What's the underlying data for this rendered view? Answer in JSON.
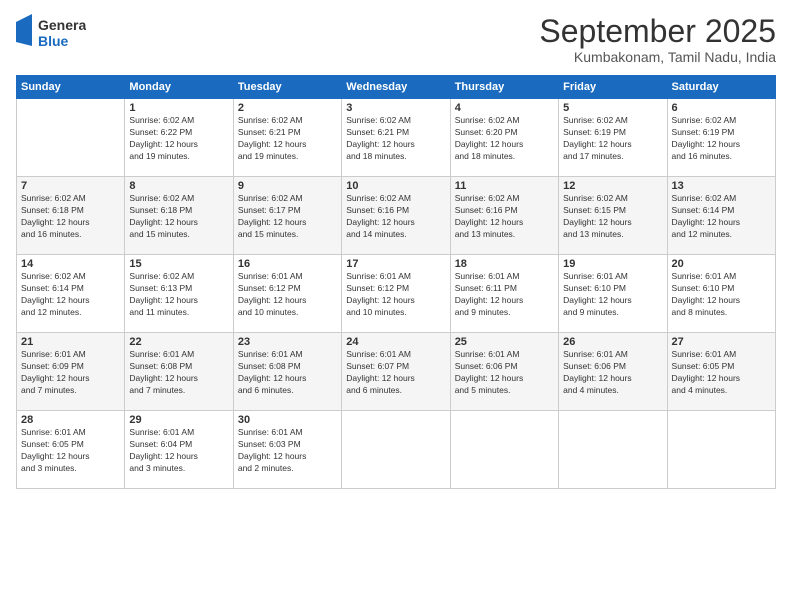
{
  "logo": {
    "line1": "General",
    "line2": "Blue"
  },
  "header": {
    "title": "September 2025",
    "subtitle": "Kumbakonam, Tamil Nadu, India"
  },
  "columns": [
    "Sunday",
    "Monday",
    "Tuesday",
    "Wednesday",
    "Thursday",
    "Friday",
    "Saturday"
  ],
  "weeks": [
    [
      {
        "day": "",
        "info": ""
      },
      {
        "day": "1",
        "info": "Sunrise: 6:02 AM\nSunset: 6:22 PM\nDaylight: 12 hours\nand 19 minutes."
      },
      {
        "day": "2",
        "info": "Sunrise: 6:02 AM\nSunset: 6:21 PM\nDaylight: 12 hours\nand 19 minutes."
      },
      {
        "day": "3",
        "info": "Sunrise: 6:02 AM\nSunset: 6:21 PM\nDaylight: 12 hours\nand 18 minutes."
      },
      {
        "day": "4",
        "info": "Sunrise: 6:02 AM\nSunset: 6:20 PM\nDaylight: 12 hours\nand 18 minutes."
      },
      {
        "day": "5",
        "info": "Sunrise: 6:02 AM\nSunset: 6:19 PM\nDaylight: 12 hours\nand 17 minutes."
      },
      {
        "day": "6",
        "info": "Sunrise: 6:02 AM\nSunset: 6:19 PM\nDaylight: 12 hours\nand 16 minutes."
      }
    ],
    [
      {
        "day": "7",
        "info": "Sunrise: 6:02 AM\nSunset: 6:18 PM\nDaylight: 12 hours\nand 16 minutes."
      },
      {
        "day": "8",
        "info": "Sunrise: 6:02 AM\nSunset: 6:18 PM\nDaylight: 12 hours\nand 15 minutes."
      },
      {
        "day": "9",
        "info": "Sunrise: 6:02 AM\nSunset: 6:17 PM\nDaylight: 12 hours\nand 15 minutes."
      },
      {
        "day": "10",
        "info": "Sunrise: 6:02 AM\nSunset: 6:16 PM\nDaylight: 12 hours\nand 14 minutes."
      },
      {
        "day": "11",
        "info": "Sunrise: 6:02 AM\nSunset: 6:16 PM\nDaylight: 12 hours\nand 13 minutes."
      },
      {
        "day": "12",
        "info": "Sunrise: 6:02 AM\nSunset: 6:15 PM\nDaylight: 12 hours\nand 13 minutes."
      },
      {
        "day": "13",
        "info": "Sunrise: 6:02 AM\nSunset: 6:14 PM\nDaylight: 12 hours\nand 12 minutes."
      }
    ],
    [
      {
        "day": "14",
        "info": "Sunrise: 6:02 AM\nSunset: 6:14 PM\nDaylight: 12 hours\nand 12 minutes."
      },
      {
        "day": "15",
        "info": "Sunrise: 6:02 AM\nSunset: 6:13 PM\nDaylight: 12 hours\nand 11 minutes."
      },
      {
        "day": "16",
        "info": "Sunrise: 6:01 AM\nSunset: 6:12 PM\nDaylight: 12 hours\nand 10 minutes."
      },
      {
        "day": "17",
        "info": "Sunrise: 6:01 AM\nSunset: 6:12 PM\nDaylight: 12 hours\nand 10 minutes."
      },
      {
        "day": "18",
        "info": "Sunrise: 6:01 AM\nSunset: 6:11 PM\nDaylight: 12 hours\nand 9 minutes."
      },
      {
        "day": "19",
        "info": "Sunrise: 6:01 AM\nSunset: 6:10 PM\nDaylight: 12 hours\nand 9 minutes."
      },
      {
        "day": "20",
        "info": "Sunrise: 6:01 AM\nSunset: 6:10 PM\nDaylight: 12 hours\nand 8 minutes."
      }
    ],
    [
      {
        "day": "21",
        "info": "Sunrise: 6:01 AM\nSunset: 6:09 PM\nDaylight: 12 hours\nand 7 minutes."
      },
      {
        "day": "22",
        "info": "Sunrise: 6:01 AM\nSunset: 6:08 PM\nDaylight: 12 hours\nand 7 minutes."
      },
      {
        "day": "23",
        "info": "Sunrise: 6:01 AM\nSunset: 6:08 PM\nDaylight: 12 hours\nand 6 minutes."
      },
      {
        "day": "24",
        "info": "Sunrise: 6:01 AM\nSunset: 6:07 PM\nDaylight: 12 hours\nand 6 minutes."
      },
      {
        "day": "25",
        "info": "Sunrise: 6:01 AM\nSunset: 6:06 PM\nDaylight: 12 hours\nand 5 minutes."
      },
      {
        "day": "26",
        "info": "Sunrise: 6:01 AM\nSunset: 6:06 PM\nDaylight: 12 hours\nand 4 minutes."
      },
      {
        "day": "27",
        "info": "Sunrise: 6:01 AM\nSunset: 6:05 PM\nDaylight: 12 hours\nand 4 minutes."
      }
    ],
    [
      {
        "day": "28",
        "info": "Sunrise: 6:01 AM\nSunset: 6:05 PM\nDaylight: 12 hours\nand 3 minutes."
      },
      {
        "day": "29",
        "info": "Sunrise: 6:01 AM\nSunset: 6:04 PM\nDaylight: 12 hours\nand 3 minutes."
      },
      {
        "day": "30",
        "info": "Sunrise: 6:01 AM\nSunset: 6:03 PM\nDaylight: 12 hours\nand 2 minutes."
      },
      {
        "day": "",
        "info": ""
      },
      {
        "day": "",
        "info": ""
      },
      {
        "day": "",
        "info": ""
      },
      {
        "day": "",
        "info": ""
      }
    ]
  ]
}
